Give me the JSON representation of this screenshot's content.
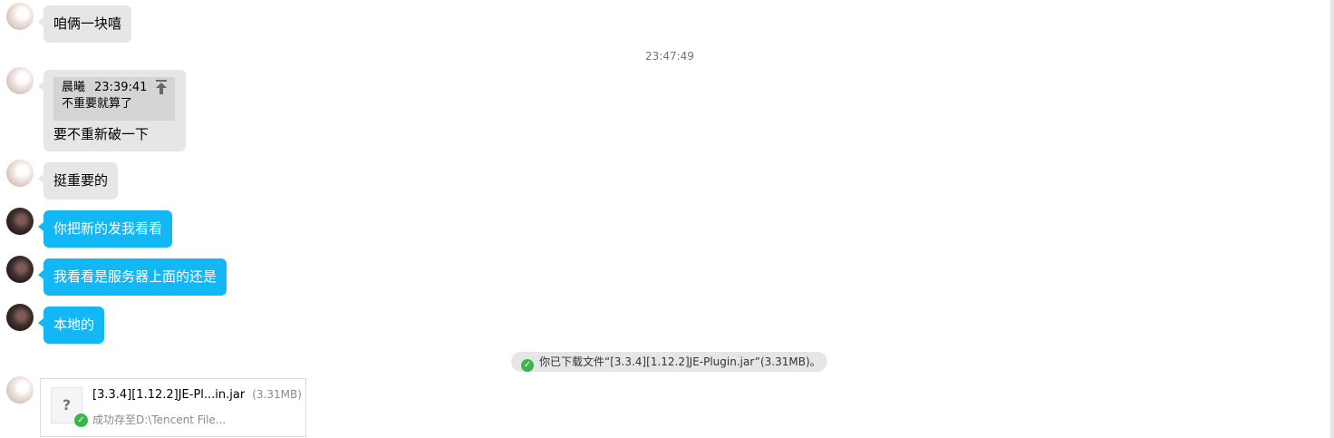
{
  "messages": [
    {
      "sender": "other",
      "text": "咱俩一块嘻"
    },
    {
      "sender": "other",
      "quote": {
        "name": "晨曦",
        "time": "23:39:41",
        "text": "不重要就算了"
      },
      "text": "要不重新破一下"
    },
    {
      "sender": "other",
      "text": "挺重要的"
    },
    {
      "sender": "self",
      "text": "你把新的发我看看"
    },
    {
      "sender": "self",
      "text": "我看看是服务器上面的还是"
    },
    {
      "sender": "self",
      "text": "本地的"
    }
  ],
  "timestamp": "23:47:49",
  "notice": {
    "icon": "check-circle-icon",
    "text": "你已下载文件“[3.3.4][1.12.2]JE-Plugin.jar”(3.31MB)。"
  },
  "file_card": {
    "icon": "unknown-file-icon",
    "icon_glyph": "?",
    "name": "[3.3.4][1.12.2]JE-Pl...in.jar",
    "size": "(3.31MB)",
    "status": "成功存至D:\\Tencent File..."
  },
  "colors": {
    "incoming_bubble": "#e6e6e6",
    "outgoing_bubble": "#12b7f5",
    "success_green": "#39b54a"
  }
}
